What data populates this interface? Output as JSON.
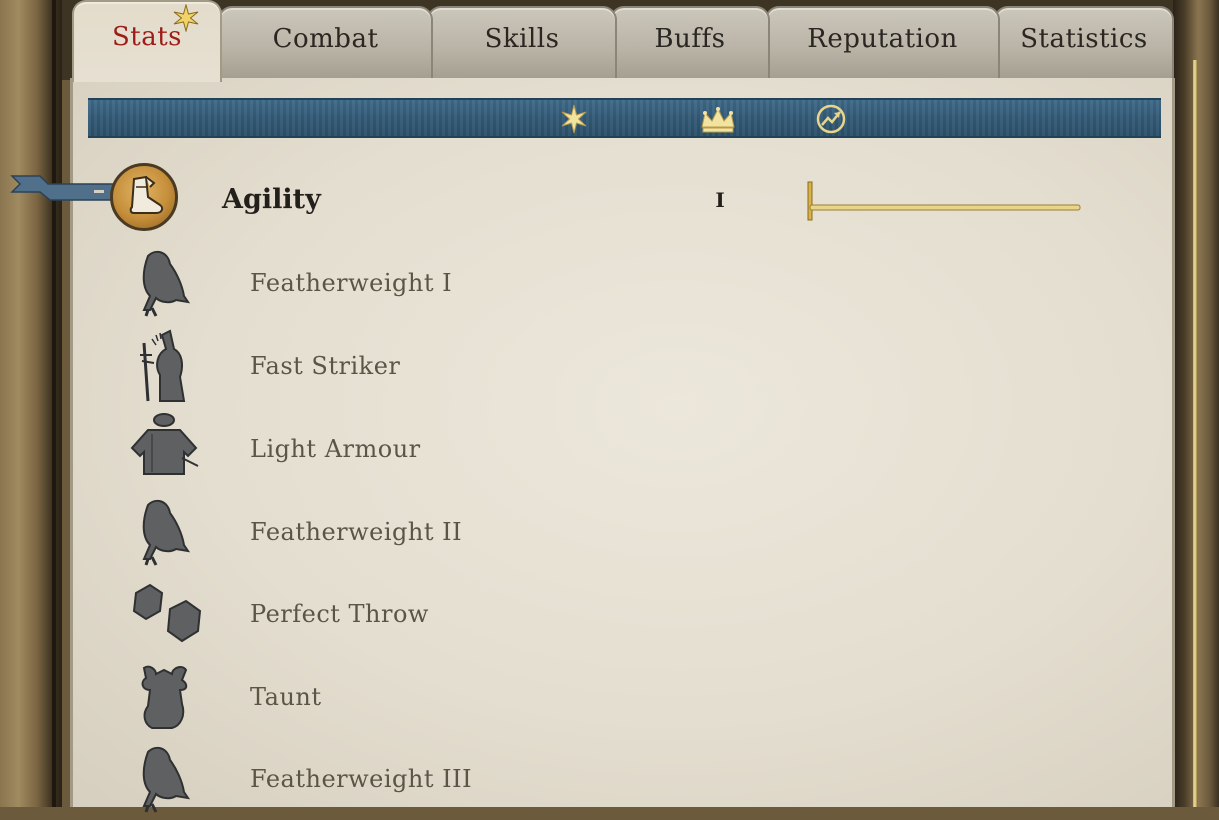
{
  "tabs": [
    {
      "label": "Stats",
      "active": true
    },
    {
      "label": "Combat",
      "active": false
    },
    {
      "label": "Skills",
      "active": false
    },
    {
      "label": "Buffs",
      "active": false
    },
    {
      "label": "Reputation",
      "active": false
    },
    {
      "label": "Statistics",
      "active": false
    }
  ],
  "banner": {
    "icons": [
      "star-icon",
      "crown-icon",
      "progress-arrow-icon"
    ]
  },
  "stat": {
    "name": "Agility",
    "value": "I",
    "icon": "boot-icon",
    "progress": 0.0
  },
  "perks": [
    {
      "label": "Featherweight I",
      "icon": "bird-icon"
    },
    {
      "label": "Fast Striker",
      "icon": "hare-icon"
    },
    {
      "label": "Light Armour",
      "icon": "tunic-icon"
    },
    {
      "label": "Featherweight II",
      "icon": "bird-icon"
    },
    {
      "label": "Perfect Throw",
      "icon": "stones-icon"
    },
    {
      "label": "Taunt",
      "icon": "jester-icon"
    },
    {
      "label": "Featherweight III",
      "icon": "bird-icon"
    }
  ],
  "colors": {
    "active_tab_text": "#9e1c17",
    "banner": "#335a77",
    "parchment": "#e6e0d2",
    "gold": "#d9b24a"
  }
}
